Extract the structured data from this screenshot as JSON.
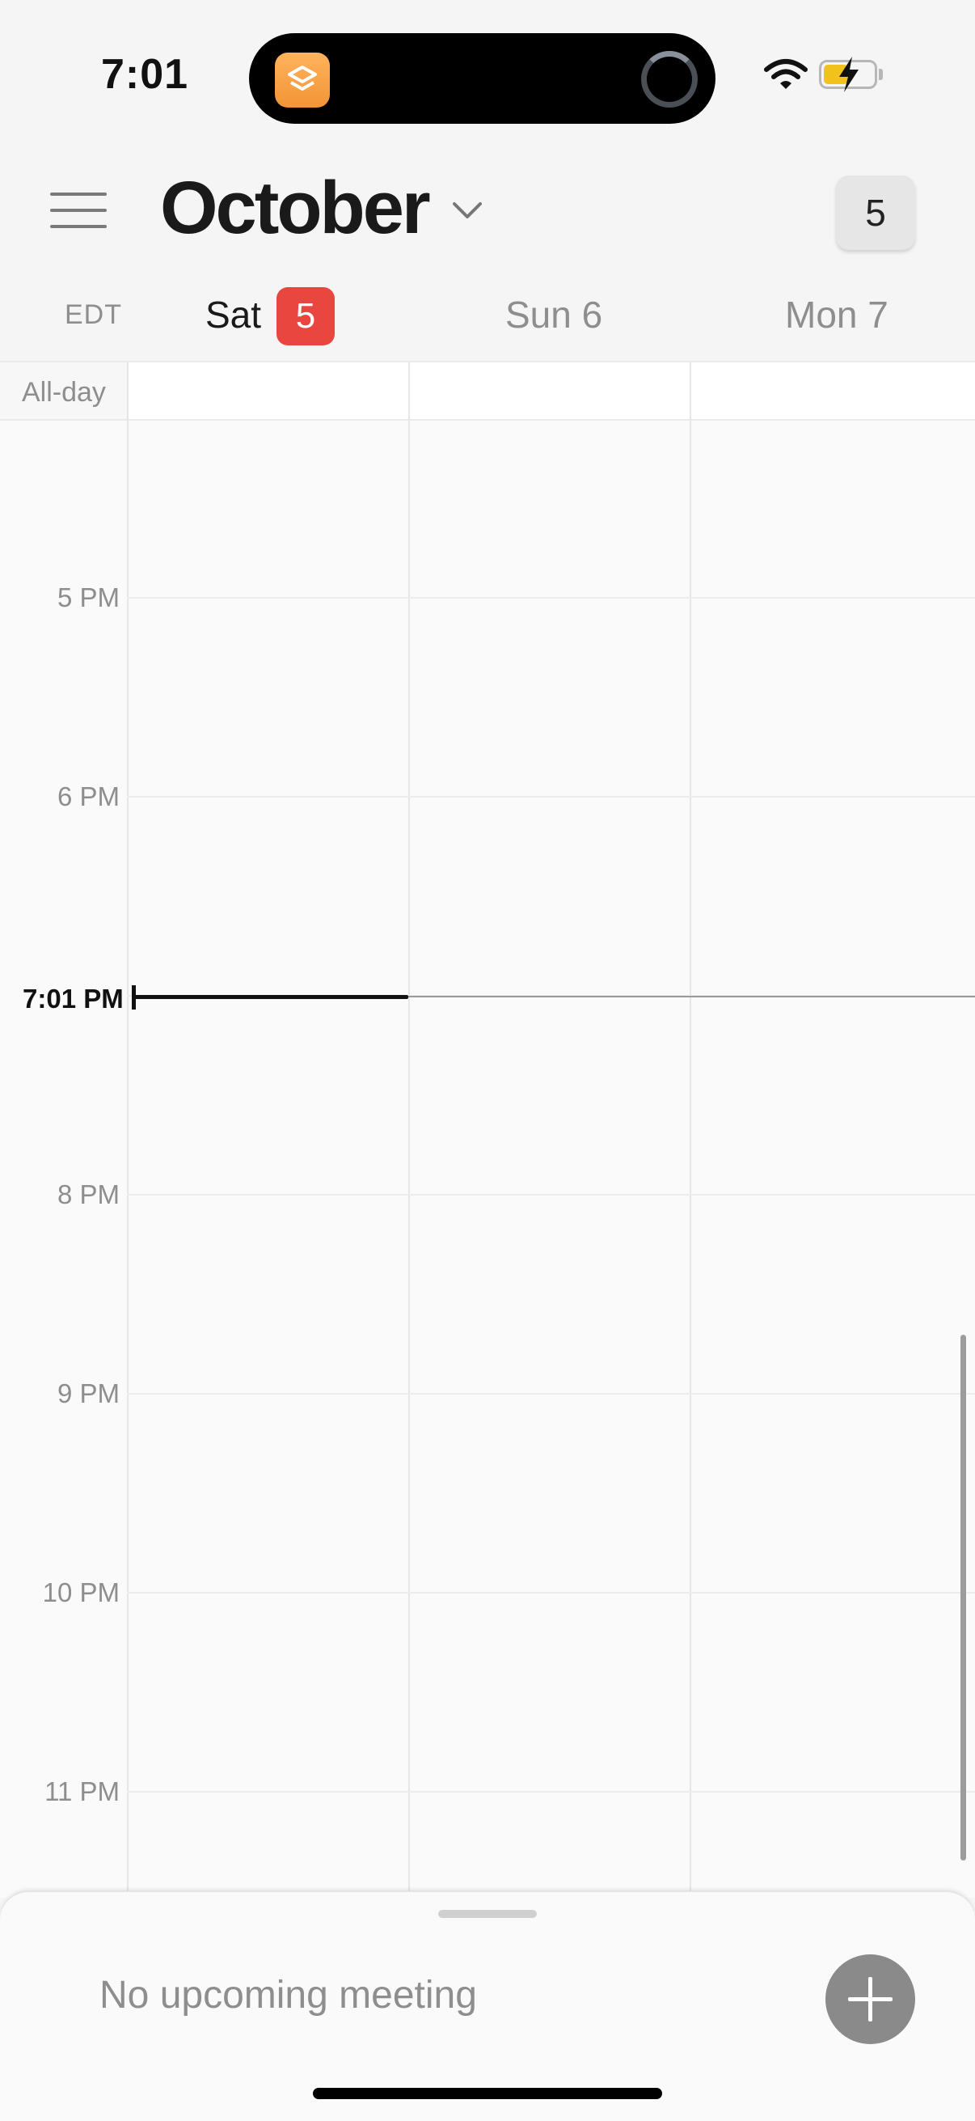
{
  "status_bar": {
    "time": "7:01"
  },
  "header": {
    "month": "October",
    "today_button": "5"
  },
  "day_header": {
    "timezone": "EDT",
    "days": [
      {
        "name": "Sat",
        "number": "5",
        "is_today": true
      },
      {
        "name": "Sun 6",
        "is_today": false
      },
      {
        "name": "Mon 7",
        "is_today": false
      }
    ]
  },
  "calendar": {
    "all_day_label": "All-day",
    "hours": [
      "5 PM",
      "6 PM",
      "8 PM",
      "9 PM",
      "10 PM",
      "11 PM"
    ],
    "current_time_label": "7:01 PM"
  },
  "bottom_sheet": {
    "message": "No upcoming meeting",
    "add_icon": "plus-icon"
  },
  "colors": {
    "today_badge": "#ea4640",
    "background": "#f5f5f5",
    "muted_text": "#8e8e8e"
  }
}
